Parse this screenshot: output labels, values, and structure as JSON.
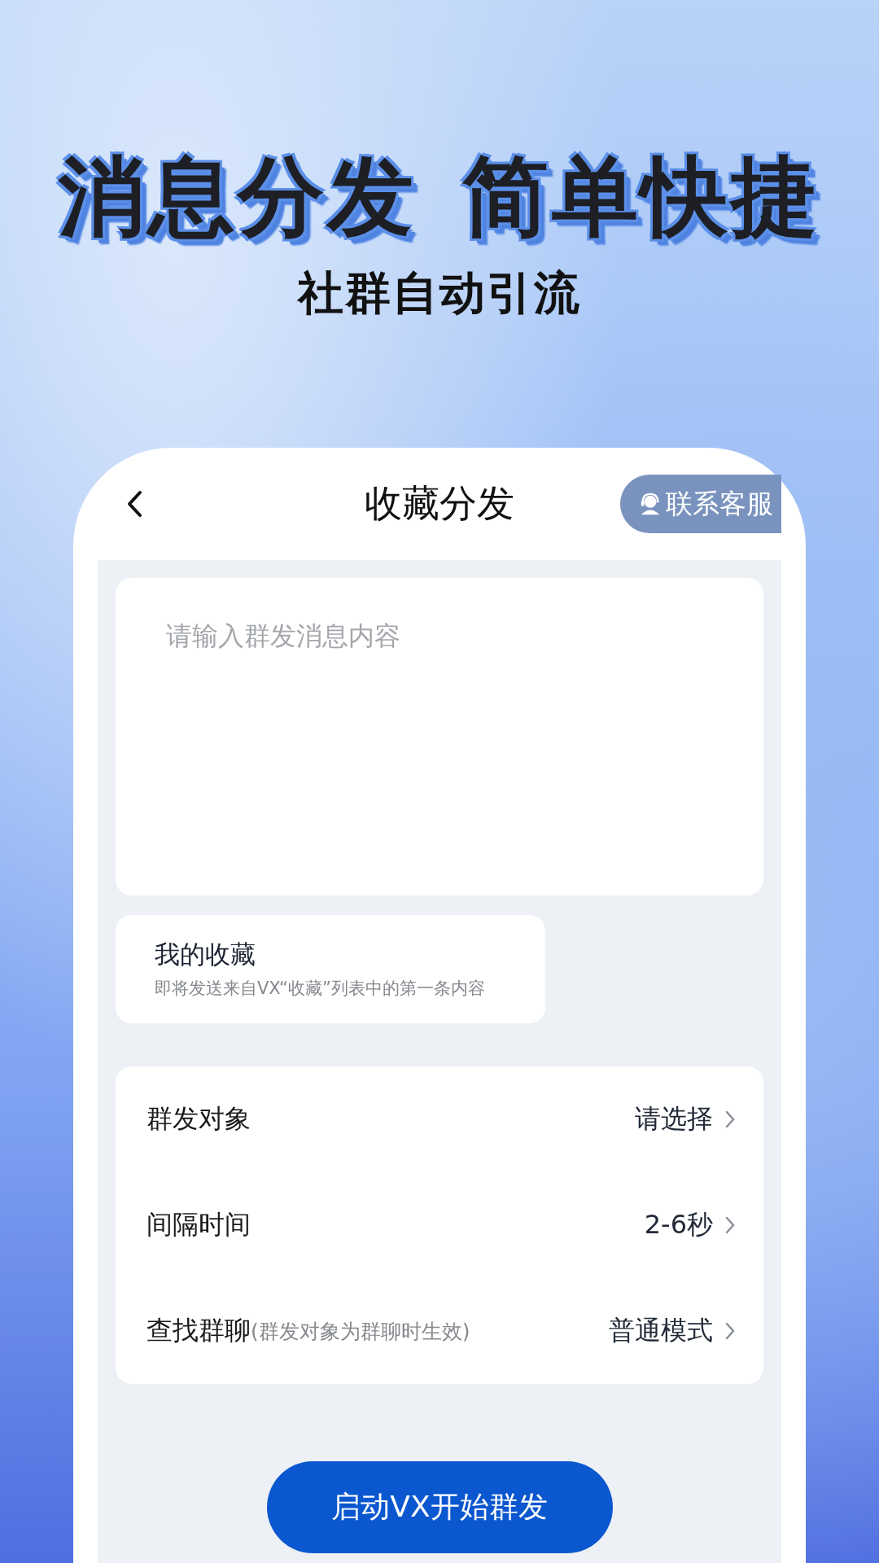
{
  "headline": [
    "消息分发",
    "简单快捷"
  ],
  "subtitle": "社群自动引流",
  "header": {
    "title": "收藏分发",
    "contact_button": "联系客服"
  },
  "message_field": {
    "placeholder": "请输入群发消息内容"
  },
  "favorites": {
    "title": "我的收藏",
    "description": "即将发送来自VX“收藏”列表中的第一条内容"
  },
  "settings": [
    {
      "label": "群发对象",
      "value": "请选择"
    },
    {
      "label": "间隔时间",
      "value": "2-6秒"
    },
    {
      "label": "查找群聊",
      "note": "(群发对象为群聊时生效)",
      "value": "普通模式"
    }
  ],
  "start_button": "启动VX开始群发"
}
